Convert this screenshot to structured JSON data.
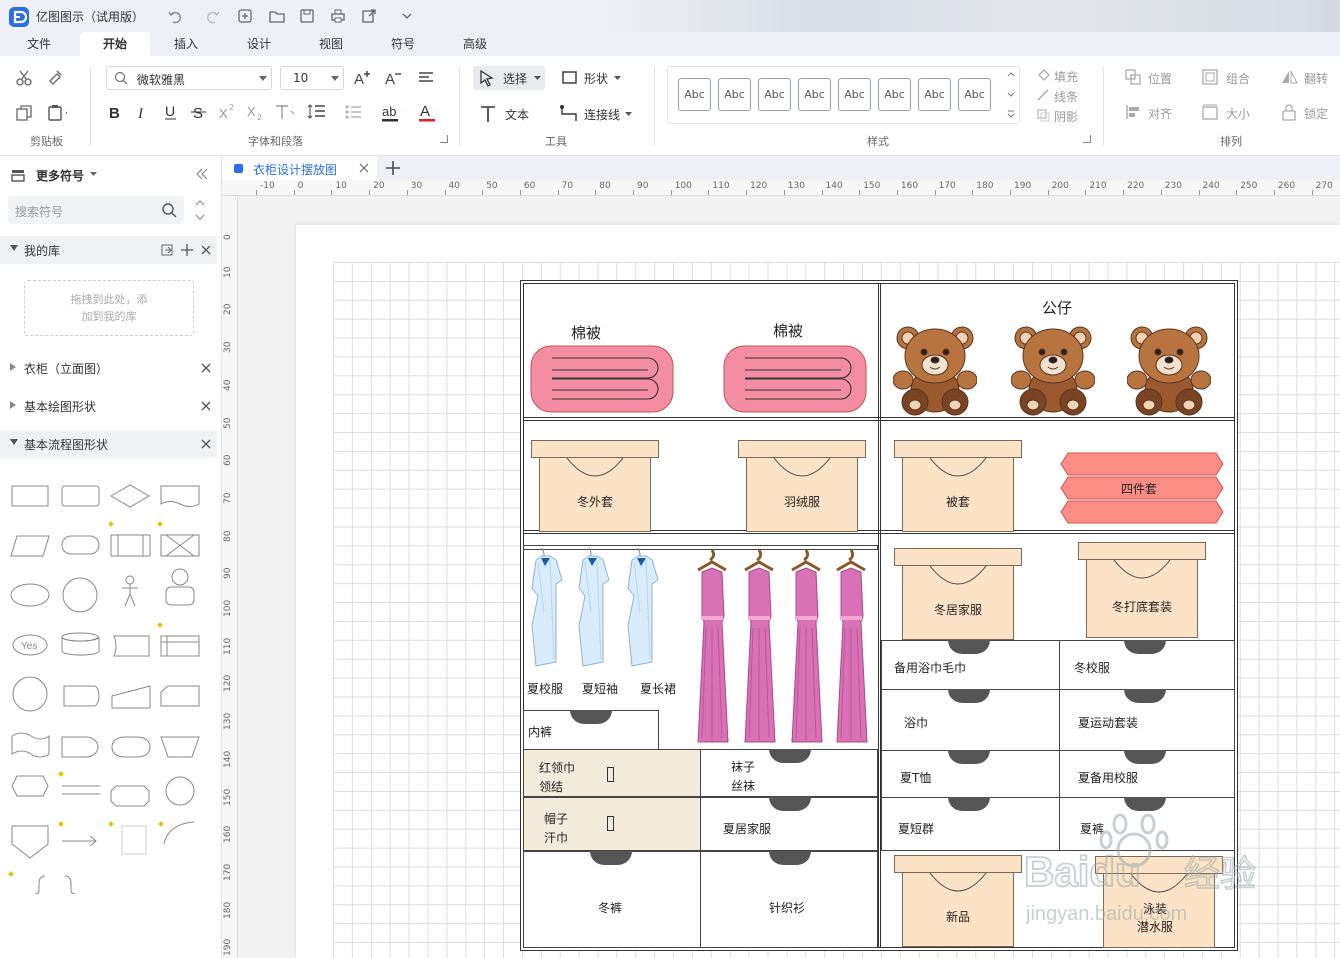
{
  "app": {
    "title": "亿图图示（试用版）"
  },
  "menu": {
    "tabs": [
      "文件",
      "开始",
      "插入",
      "设计",
      "视图",
      "符号",
      "高级"
    ],
    "active": "开始"
  },
  "ribbon": {
    "groups": {
      "clipboard": "剪贴板",
      "font_para": "字体和段落",
      "tools": "工具",
      "styles": "样式",
      "arrange": "排列"
    },
    "font_name": "微软雅黑",
    "font_size": "10",
    "select": "选择",
    "shape": "形状",
    "text": "文本",
    "connector": "连接线",
    "abc_label": "Abc",
    "fill": "填充",
    "line": "线条",
    "shadow": "阴影",
    "position": "位置",
    "group": "组合",
    "flip": "翻转",
    "align": "对齐",
    "size": "大小",
    "lock": "锁定"
  },
  "sidebar": {
    "title": "更多符号",
    "search_placeholder": "搜索符号",
    "my_library": "我的库",
    "drop_hint_1": "拖拽到此处，添",
    "drop_hint_2": "加到我的库",
    "sections": [
      "衣柜（立面图）",
      "基本绘图形状",
      "基本流程图形状"
    ],
    "shape_yes": "Yes"
  },
  "document": {
    "tab_name": "衣柜设计摆放图"
  },
  "ruler": {
    "top": [
      "-10",
      "0",
      "10",
      "20",
      "30",
      "40",
      "50",
      "60",
      "70",
      "80",
      "90",
      "100",
      "110",
      "120",
      "130",
      "140",
      "150",
      "160",
      "170",
      "180",
      "190",
      "200",
      "210",
      "220",
      "230",
      "240",
      "250",
      "260",
      "270"
    ],
    "left": [
      "0",
      "10",
      "20",
      "30",
      "40",
      "50",
      "60",
      "70",
      "80",
      "90",
      "100",
      "110",
      "120",
      "130",
      "140",
      "150",
      "160",
      "170",
      "180",
      "190"
    ]
  },
  "diagram": {
    "quilt_1": "棉被",
    "quilt_2": "棉被",
    "dolls": "公仔",
    "box_winter_coat": "冬外套",
    "box_down": "羽绒服",
    "box_cover": "被套",
    "four_piece": "四件套",
    "summer_uniform": "夏校服",
    "summer_short": "夏短袖",
    "summer_long": "夏长裙",
    "box_winter_home": "冬居家服",
    "box_winter_base": "冬打底套装",
    "underwear": "内裤",
    "red_scarf_1": "红领巾",
    "red_scarf_2": "领结",
    "socks_1": "袜子",
    "socks_2": "丝袜",
    "hat_1": "帽子",
    "hat_2": "汗巾",
    "summer_home": "夏居家服",
    "winter_pants": "冬裤",
    "knitwear": "针织衫",
    "bath_towel_spare": "备用浴巾毛巾",
    "winter_uniform": "冬校服",
    "bath_towel": "浴巾",
    "summer_sport": "夏运动套装",
    "summer_tshirt": "夏T恤",
    "summer_spare_uniform": "夏备用校服",
    "summer_skirt": "夏短群",
    "summer_pants": "夏裤",
    "new_item": "新品",
    "swim_1": "泳装",
    "swim_2": "潜水服"
  },
  "watermark": {
    "brand": "Baidu",
    "cn": "经验",
    "url": "jingyan.baidu.com"
  }
}
